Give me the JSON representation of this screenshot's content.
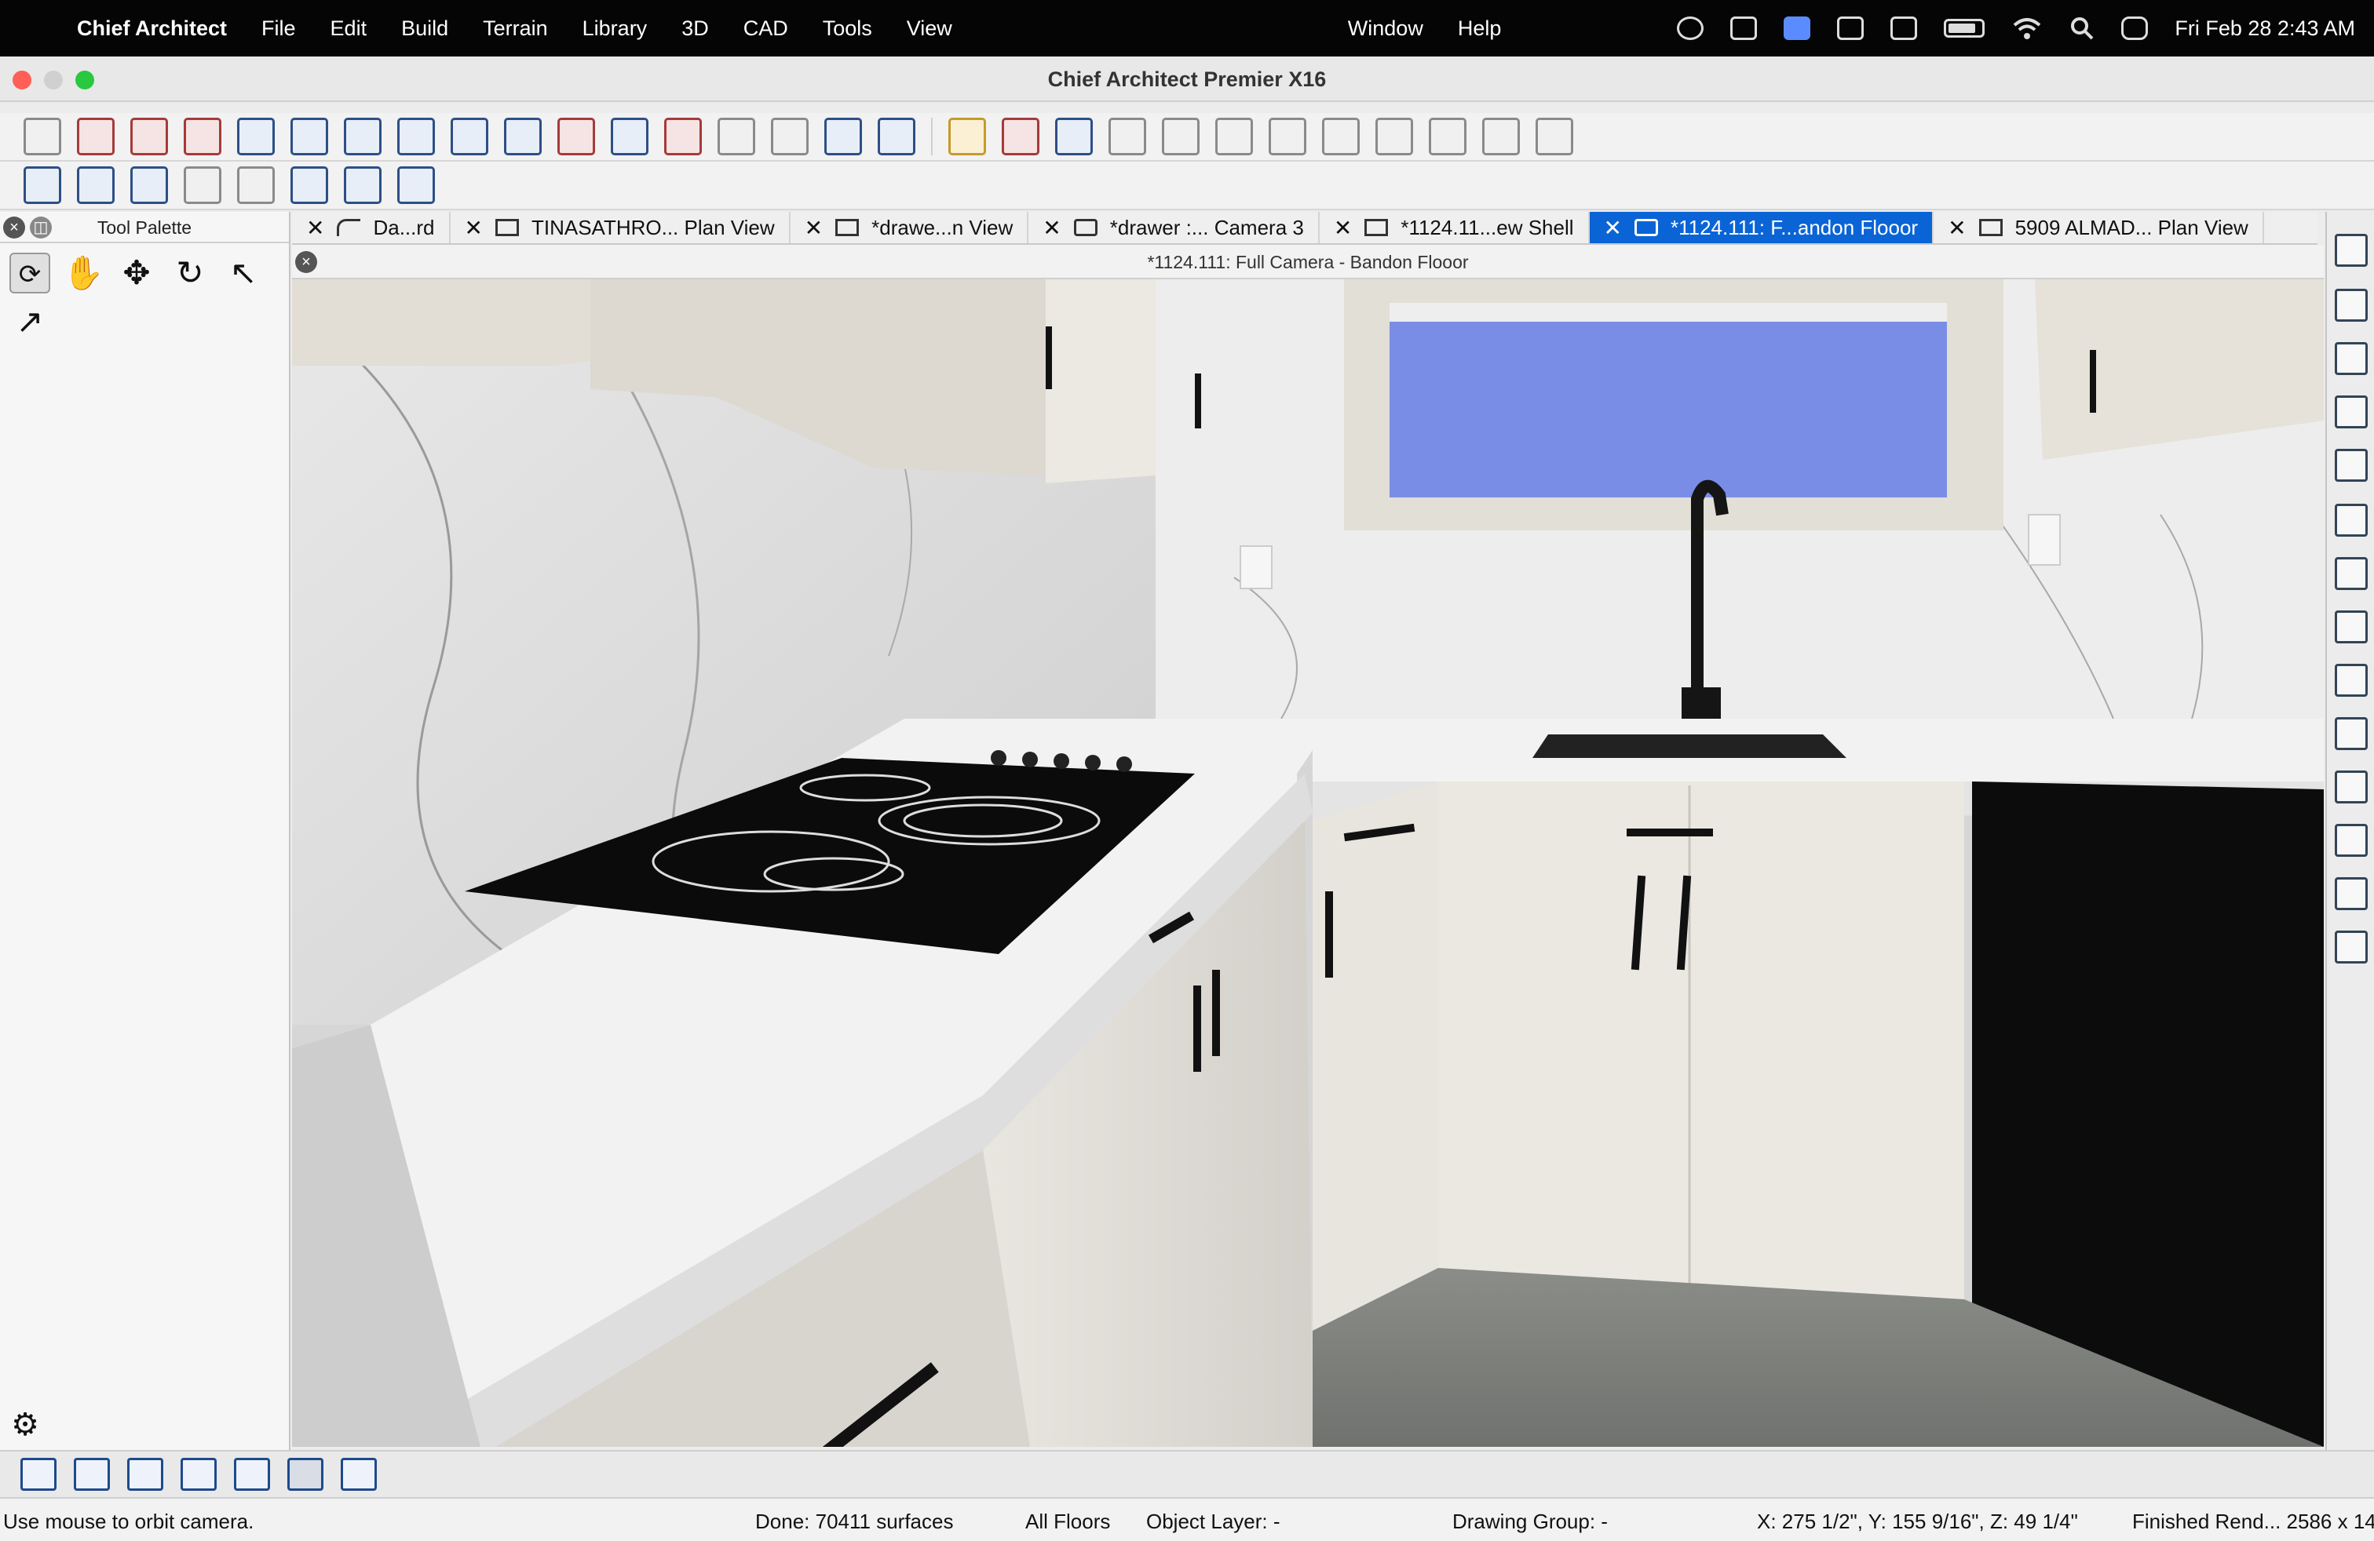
{
  "menubar": {
    "app_name": "Chief Architect",
    "items": [
      "File",
      "Edit",
      "Build",
      "Terrain",
      "Library",
      "3D",
      "CAD",
      "Tools",
      "View"
    ],
    "right_items": [
      "Window",
      "Help"
    ],
    "clock": "Fri Feb 28  2:43 AM"
  },
  "window": {
    "title": "Chief Architect Premier X16"
  },
  "palette": {
    "title": "Tool Palette"
  },
  "tabs": [
    {
      "label": "Da...rd",
      "active": false
    },
    {
      "label": "TINASATHRO... Plan View",
      "active": false
    },
    {
      "label": "*drawe...n View",
      "active": false
    },
    {
      "label": "*drawer :... Camera 3",
      "active": false
    },
    {
      "label": "*1124.11...ew Shell",
      "active": false
    },
    {
      "label": "*1124.111: F...andon Flooor",
      "active": true
    },
    {
      "label": "5909 ALMAD... Plan View",
      "active": false
    }
  ],
  "view": {
    "title": "*1124.111: Full Camera - Bandon Flooor"
  },
  "status": {
    "hint": "Use mouse to orbit camera.",
    "done": "Done:  70411 surfaces",
    "floors": "All Floors",
    "layer": "Object Layer: -",
    "group": "Drawing Group: -",
    "coords": "X: 275 1/2\", Y: 155 9/16\", Z: 49 1/4\"",
    "render": "Finished Rend...  2586 x 14..."
  },
  "colors": {
    "accent": "#0a64d6",
    "menubar": "#050505"
  }
}
